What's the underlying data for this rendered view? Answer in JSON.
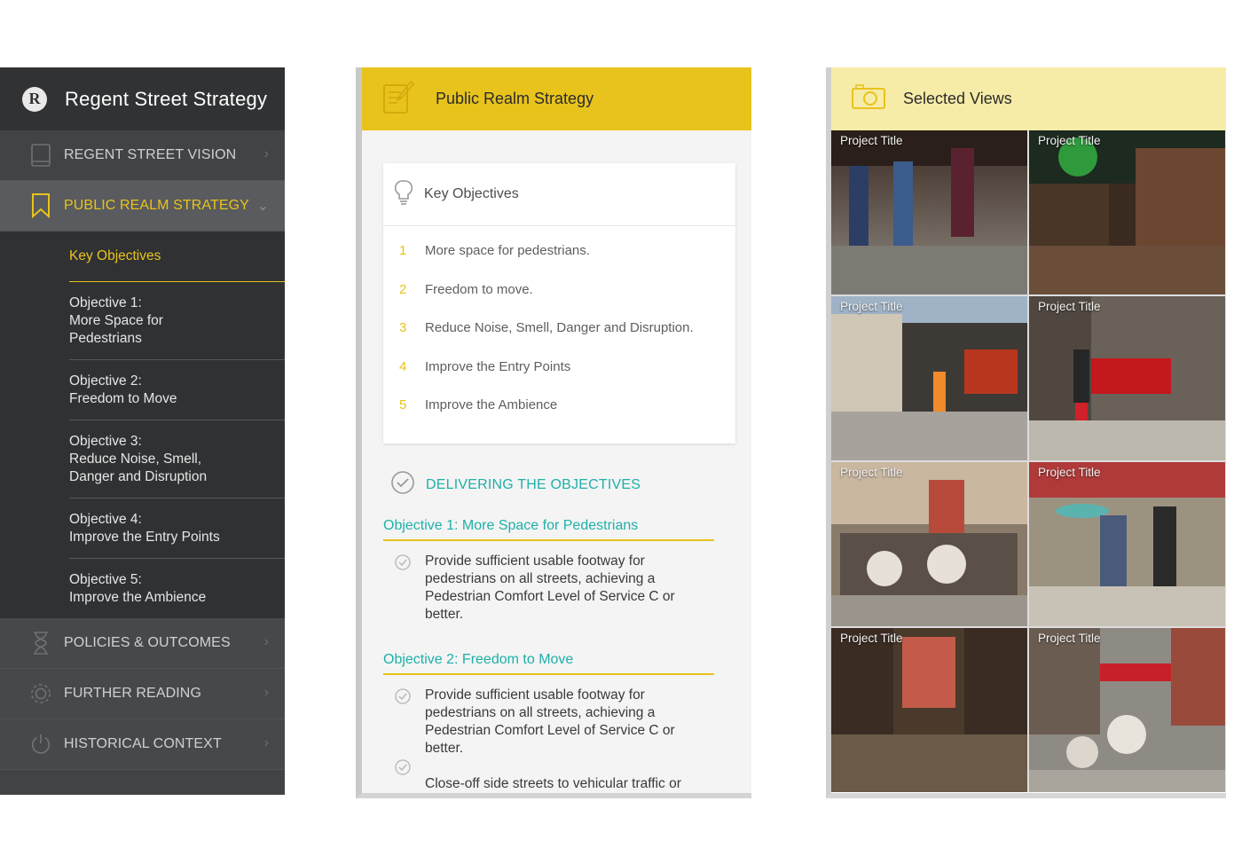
{
  "nav": {
    "logo_letter": "R",
    "title": "Regent Street Strategy",
    "items": [
      {
        "label": "REGENT STREET VISION",
        "icon": "tablet-icon"
      },
      {
        "label": "PUBLIC REALM STRATEGY",
        "icon": "bookmark-icon"
      }
    ],
    "sub_items": [
      {
        "label": "Key Objectives"
      },
      {
        "line1": "Objective 1:",
        "line2": "More Space for",
        "line3": "Pedestrians"
      },
      {
        "line1": "Objective 2:",
        "line2": "Freedom to Move"
      },
      {
        "line1": "Objective 3:",
        "line2": "Reduce Noise, Smell,",
        "line3": "Danger and Disruption"
      },
      {
        "line1": "Objective 4:",
        "line2": "Improve the Entry Points"
      },
      {
        "line1": "Objective 5:",
        "line2": "Improve the Ambience"
      }
    ],
    "bottom_items": [
      {
        "label": "POLICIES & OUTCOMES",
        "icon": "hourglass-icon"
      },
      {
        "label": "FURTHER READING",
        "icon": "gear-icon"
      },
      {
        "label": "HISTORICAL CONTEXT",
        "icon": "power-icon"
      }
    ],
    "colors": {
      "accent": "#e8c31c",
      "background": "#414346"
    }
  },
  "strategy": {
    "title": "Public Realm Strategy",
    "card_title": "Key Objectives",
    "objectives": [
      {
        "num": "1",
        "text": "More space for pedestrians."
      },
      {
        "num": "2",
        "text": "Freedom to move."
      },
      {
        "num": "3",
        "text": "Reduce Noise, Smell, Danger and Disruption."
      },
      {
        "num": "4",
        "text": "Improve the Entry Points"
      },
      {
        "num": "5",
        "text": "Improve the Ambience"
      }
    ],
    "delivering_title": "DELIVERING THE OBJECTIVES",
    "sections": [
      {
        "title": "Objective 1: More Space for Pedestrians",
        "bullets": [
          "Provide sufficient usable footway for pedestrians on all streets, achieving a Pedestrian Comfort Level of Service C or better."
        ]
      },
      {
        "title": "Objective 2: Freedom to Move",
        "bullets": [
          "Provide sufficient usable footway for pedestrians on all streets, achieving a Pedestrian Comfort Level of Service C or better.",
          "Close-off side streets to vehicular traffic or"
        ]
      }
    ],
    "colors": {
      "header": "#e8c31c",
      "teal": "#1eb0a8"
    }
  },
  "gallery": {
    "title": "Selected Views",
    "tiles": [
      {
        "label": "Project Title"
      },
      {
        "label": "Project Title"
      },
      {
        "label": "Project Title"
      },
      {
        "label": "Project Title"
      },
      {
        "label": "Project Title"
      },
      {
        "label": "Project Title"
      },
      {
        "label": "Project Title"
      },
      {
        "label": "Project Title"
      }
    ],
    "colors": {
      "header": "#f7eba8"
    }
  }
}
